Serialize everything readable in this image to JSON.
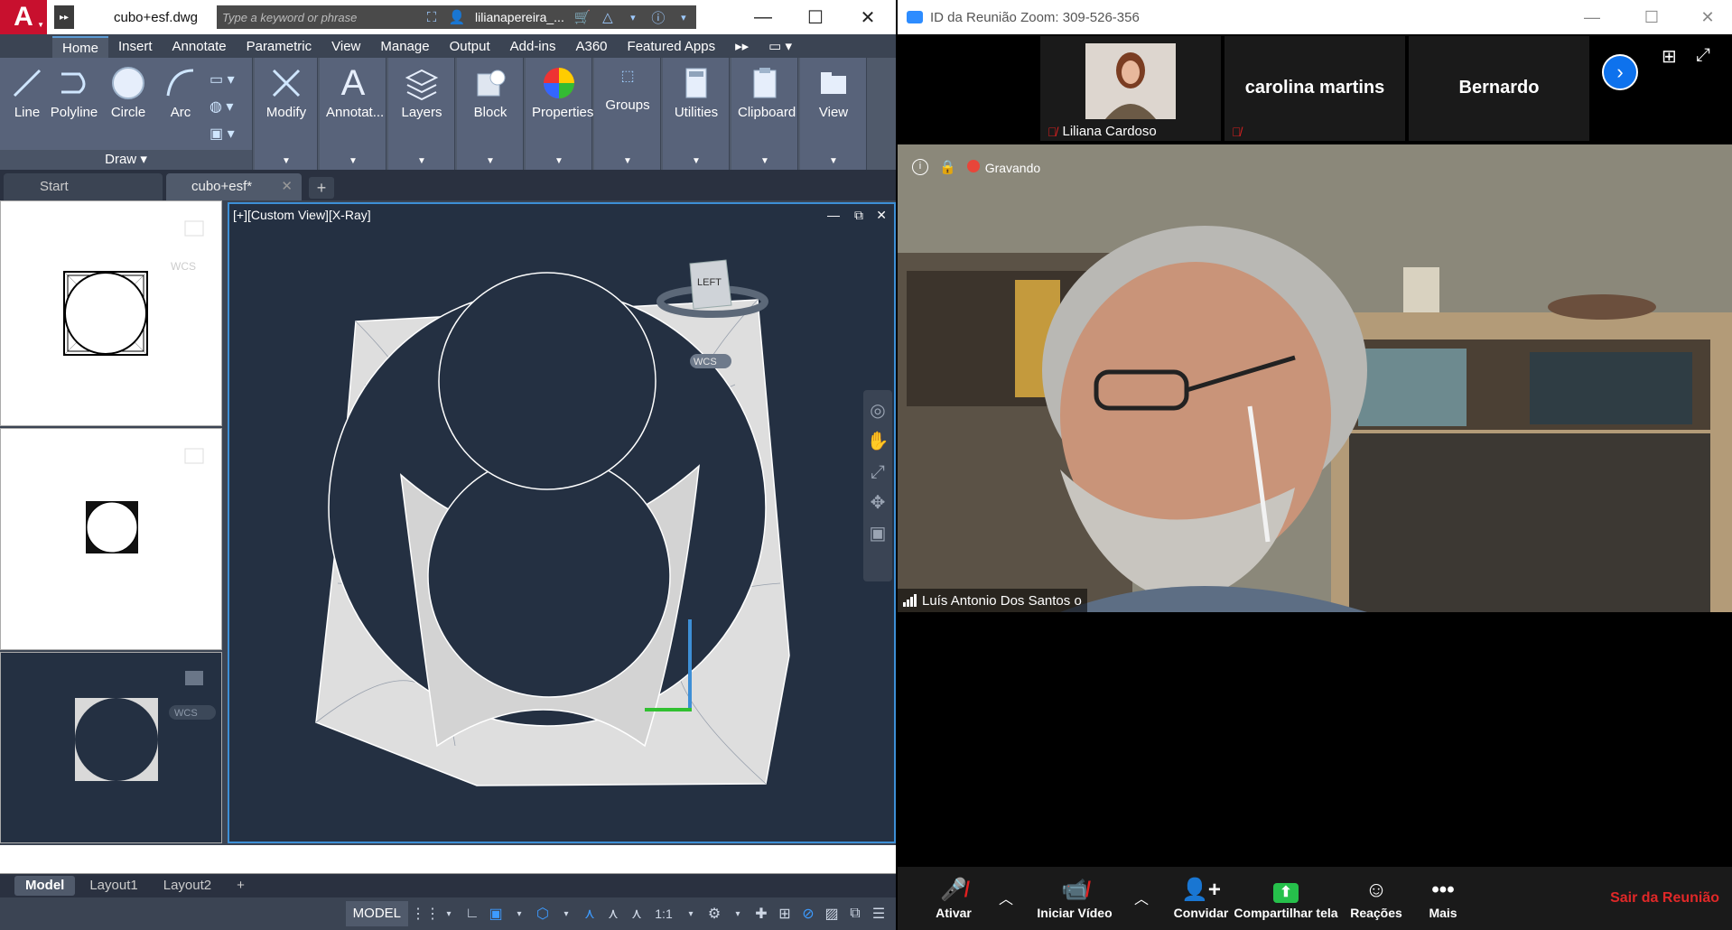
{
  "autocad": {
    "doc_title": "cubo+esf.dwg",
    "search": {
      "placeholder": "Type a keyword or phrase"
    },
    "user": "lilianapereira_...",
    "ribbon_tabs": [
      "Home",
      "Insert",
      "Annotate",
      "Parametric",
      "View",
      "Manage",
      "Output",
      "Add-ins",
      "A360",
      "Featured Apps"
    ],
    "active_tab": "Home",
    "draw_tools": [
      "Line",
      "Polyline",
      "Circle",
      "Arc"
    ],
    "draw_panel_label": "Draw",
    "panels": [
      "Modify",
      "Annotat...",
      "Layers",
      "Block",
      "Properties",
      "Groups",
      "Utilities",
      "Clipboard",
      "View"
    ],
    "file_tabs": {
      "start": "Start",
      "current": "cubo+esf*"
    },
    "viewport_label": "[+][Custom View][X-Ray]",
    "viewcube_face": "LEFT",
    "wcs_label": "WCS",
    "layout_tabs": [
      "Model",
      "Layout1",
      "Layout2"
    ],
    "status": {
      "model": "MODEL",
      "scale": "1:1"
    }
  },
  "zoom": {
    "title": "ID da Reunião Zoom: 309-526-356",
    "participants": [
      {
        "name": "Liliana Cardoso",
        "muted": true
      },
      {
        "name": "carolina martins",
        "muted": true
      },
      {
        "name": "Bernardo",
        "muted": false
      }
    ],
    "recording_label": "Gravando",
    "speaker_name": "Luís Antonio Dos Santos o",
    "toolbar": {
      "mute": "Ativar",
      "video": "Iniciar Vídeo",
      "invite": "Convidar",
      "share": "Compartilhar tela",
      "reactions": "Reações",
      "more": "Mais",
      "leave": "Sair da Reunião"
    },
    "colors": {
      "accent": "#0e72ed",
      "leave": "#e02828",
      "share": "#26c04b"
    }
  }
}
